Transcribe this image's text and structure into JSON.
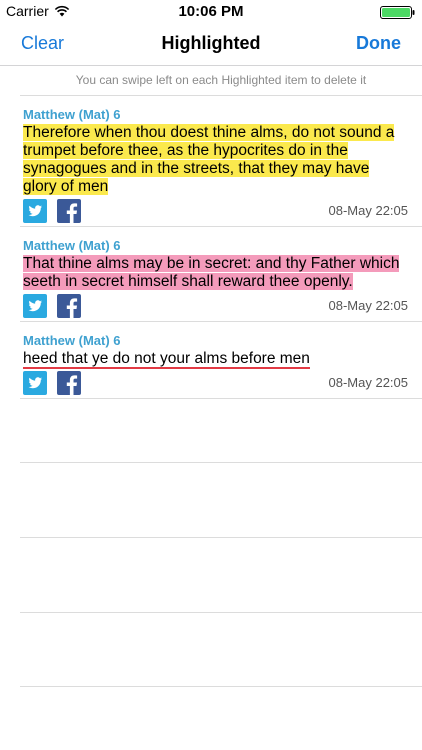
{
  "status": {
    "carrier": "Carrier",
    "time": "10:06 PM"
  },
  "nav": {
    "left_label": "Clear",
    "title": "Highlighted",
    "right_label": "Done"
  },
  "hint": "You can swipe left on each Highlighted item to delete it",
  "items": [
    {
      "ref": "Matthew (Mat) 6",
      "text": "Therefore when thou doest thine alms, do not sound a trumpet before thee, as the hypocrites do in the synagogues and in the streets, that they may have glory of men",
      "date": "08-May 22:05",
      "style": "yellow"
    },
    {
      "ref": "Matthew (Mat) 6",
      "text": "That thine alms may be in secret: and thy Father which seeth in secret himself shall reward thee openly.",
      "date": "08-May 22:05",
      "style": "pink"
    },
    {
      "ref": "Matthew (Mat) 6",
      "text": "heed that ye do not your alms before men",
      "date": "08-May 22:05",
      "style": "underline"
    }
  ],
  "icons": {
    "twitter": "twitter-icon",
    "facebook": "facebook-icon"
  },
  "colors": {
    "accent": "#1779d9",
    "reference": "#3fa1d0",
    "highlight_yellow": "#fbe94d",
    "highlight_pink": "#f49bbb",
    "underline": "#e23a44",
    "twitter": "#2aa9e0",
    "facebook": "#3b5998",
    "battery": "#4cd964"
  }
}
